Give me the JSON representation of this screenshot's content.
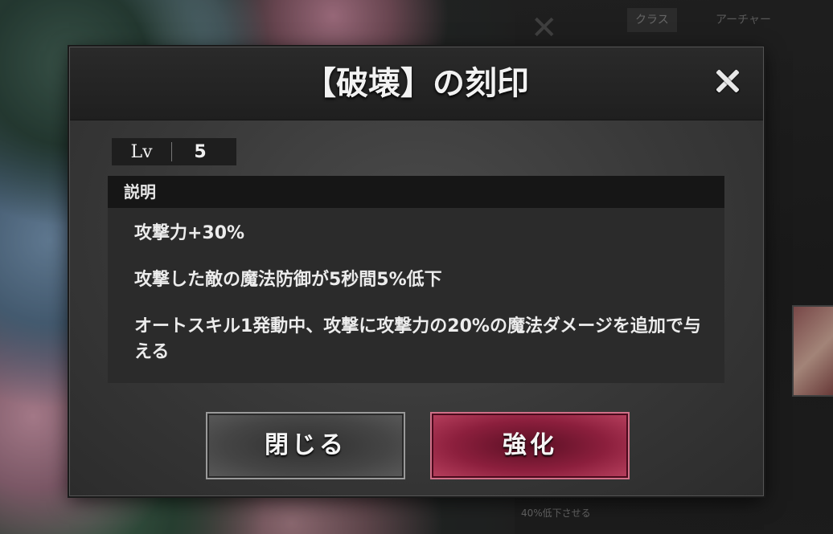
{
  "background": {
    "class_tag": "クラス",
    "class_value": "アーチャー",
    "bottom_text": "40%低下させる"
  },
  "dialog": {
    "title": "【破壊】の刻印",
    "level": {
      "label": "Lv",
      "value": "5"
    },
    "description": {
      "header": "説明",
      "lines": [
        "攻撃力+30%",
        "攻撃した敵の魔法防御が5秒間5%低下",
        "オートスキル1発動中、攻撃に攻撃力の20%の魔法ダメージを追加で与える"
      ]
    },
    "buttons": {
      "close_label": "閉じる",
      "enhance_label": "強化"
    }
  },
  "colors": {
    "enhance_button": "#8c1f3d",
    "close_button": "#454545",
    "dialog_background": "#383838"
  },
  "icons": {
    "close": "close-icon"
  }
}
